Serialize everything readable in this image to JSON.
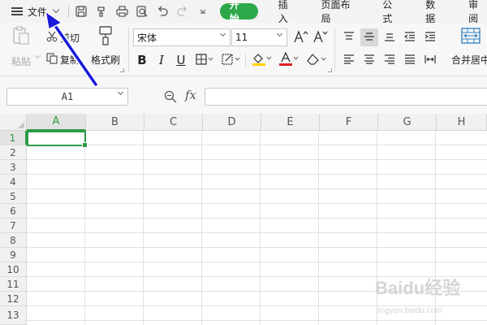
{
  "menubar": {
    "file_label": "文件",
    "quick_access_icons": [
      "save-icon",
      "format-painter-icon",
      "print-icon",
      "print-preview-icon",
      "undo-icon",
      "redo-icon",
      "customize-icon"
    ],
    "tabs": [
      {
        "label": "开始",
        "active": true
      },
      {
        "label": "插入",
        "active": false
      },
      {
        "label": "页面布局",
        "active": false
      },
      {
        "label": "公式",
        "active": false
      },
      {
        "label": "数据",
        "active": false
      },
      {
        "label": "审阅",
        "active": false
      }
    ],
    "active_tab_color": "#2da84a"
  },
  "ribbon": {
    "paste_label": "粘贴",
    "cut_label": "剪切",
    "copy_label": "复制",
    "format_painter_label": "格式刷",
    "font_name": "宋体",
    "font_size": "11",
    "bold_label": "B",
    "italic_label": "I",
    "underline_label": "U",
    "merge_center_label": "合并居中",
    "font_color": "#e02020",
    "fill_color": "#ffd400"
  },
  "formula_bar": {
    "cell_reference": "A1",
    "fx_label": "fx",
    "formula_value": ""
  },
  "sheet": {
    "columns": [
      "A",
      "B",
      "C",
      "D",
      "E",
      "F",
      "G",
      "H"
    ],
    "rows": [
      "1",
      "2",
      "3",
      "4",
      "5",
      "6",
      "7",
      "8",
      "9",
      "10",
      "11",
      "12",
      "13"
    ],
    "selected_cell": "A1",
    "selection_color": "#2d9b47"
  },
  "annotation": {
    "arrow_color": "#1a1adb"
  },
  "watermark": {
    "text": "Baidu经验",
    "url_text": "jingyan.baidu.com"
  }
}
